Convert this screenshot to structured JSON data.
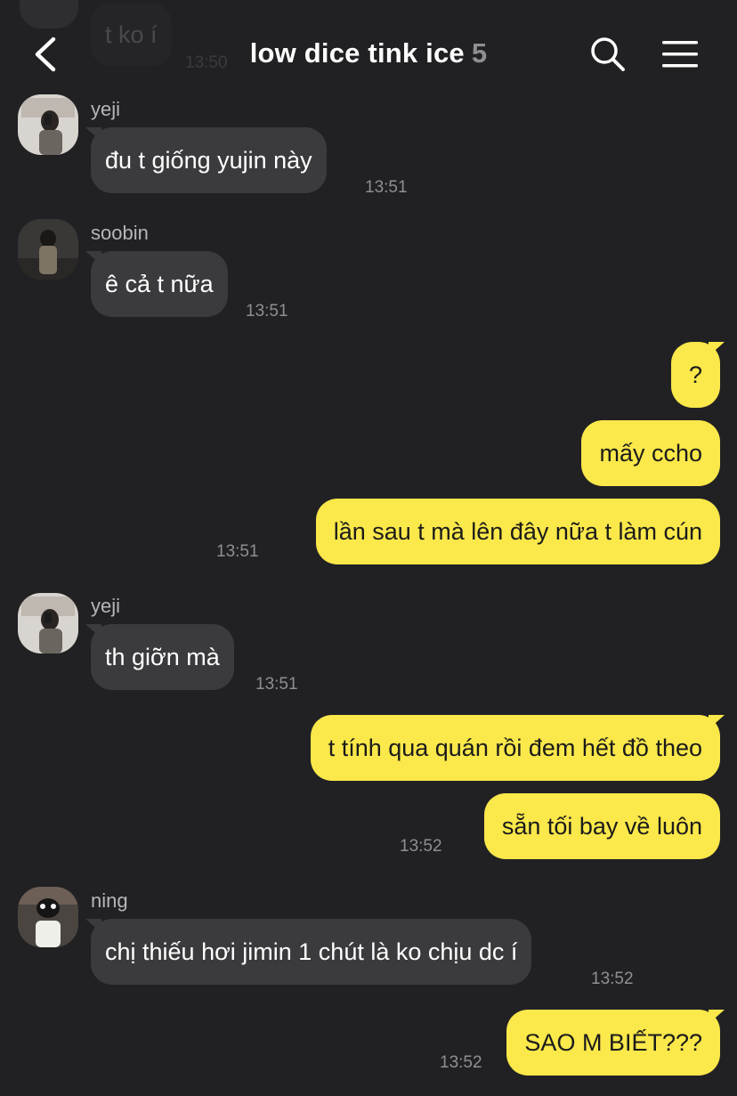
{
  "header": {
    "back_icon": "chevron-left-icon",
    "title": "low dice tink ice",
    "member_count": "5",
    "search_icon": "search-icon",
    "menu_icon": "hamburger-menu-icon"
  },
  "previous_message": {
    "text": "t ko í",
    "time": "13:50"
  },
  "messages": [
    {
      "sender": "yeji",
      "text": "đu t giống yujin này",
      "time": "13:51"
    },
    {
      "sender": "soobin",
      "text": "ê cả t nữa",
      "time": "13:51"
    },
    {
      "text": "?"
    },
    {
      "text": "mấy ccho"
    },
    {
      "text": "lần sau t mà lên đây nữa t làm cún",
      "time": "13:51"
    },
    {
      "sender": "yeji",
      "text": "th giỡn mà",
      "time": "13:51"
    },
    {
      "text": "t tính qua quán rồi đem hết đồ theo"
    },
    {
      "text": "sẵn tối bay về luôn",
      "time": "13:52"
    },
    {
      "sender": "ning",
      "text": "chị thiếu hơi jimin 1 chút là ko chịu dc í",
      "time": "13:52"
    },
    {
      "text": "SAO M BIẾT???",
      "time": "13:52"
    }
  ],
  "colors": {
    "background": "#212124",
    "incoming_bubble": "#3b3b3e",
    "outgoing_bubble": "#fbe84a",
    "timestamp": "#8e8e93"
  }
}
